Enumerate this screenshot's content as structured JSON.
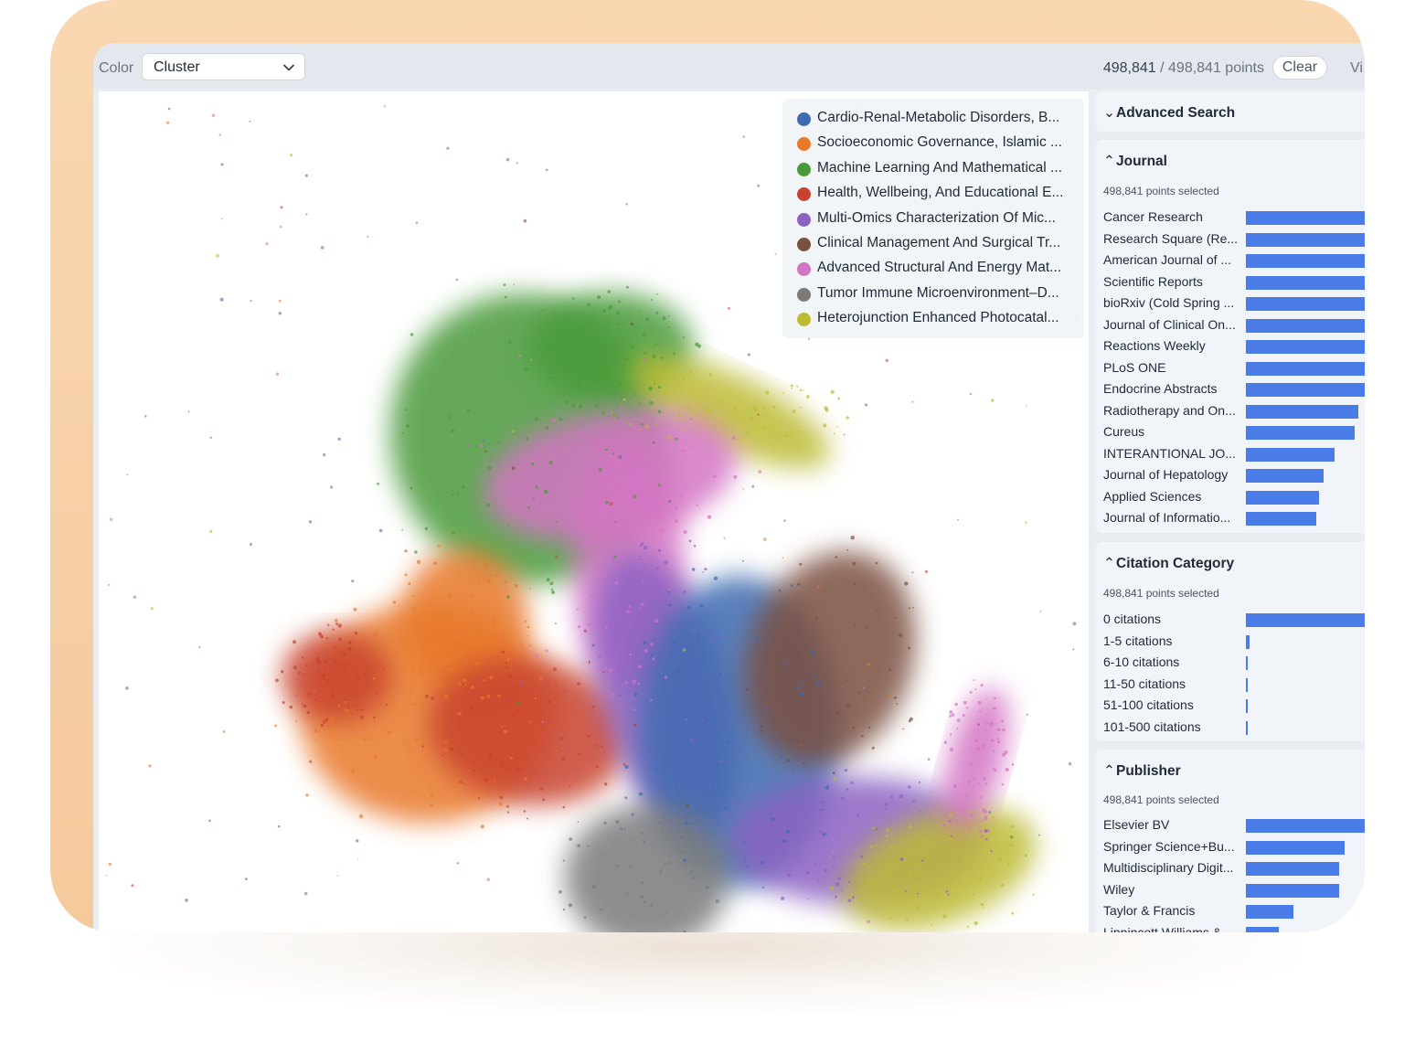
{
  "toolbar": {
    "color_label": "Color",
    "color_select_value": "Cluster",
    "points_selected": "498,841",
    "points_total": "/ 498,841 points",
    "clear_label": "Clear",
    "view_label": "Vi"
  },
  "legend": {
    "items": [
      {
        "label": "Cardio-Renal-Metabolic Disorders, B...",
        "color": "#3d6bb0"
      },
      {
        "label": "Socioeconomic Governance, Islamic ...",
        "color": "#e8782a"
      },
      {
        "label": "Machine Learning And Mathematical ...",
        "color": "#4a9a3a"
      },
      {
        "label": "Health, Wellbeing, And Educational E...",
        "color": "#c8422f"
      },
      {
        "label": "Multi-Omics Characterization Of Mic...",
        "color": "#8b62c2"
      },
      {
        "label": "Clinical Management And Surgical Tr...",
        "color": "#7a5041"
      },
      {
        "label": "Advanced Structural And Energy Mat...",
        "color": "#d474c4"
      },
      {
        "label": "Tumor Immune Microenvironment–D...",
        "color": "#7a7a7a"
      },
      {
        "label": "Heterojunction Enhanced Photocatal...",
        "color": "#bdbb35"
      }
    ]
  },
  "sidebar": {
    "advanced_search": {
      "title": "Advanced Search"
    },
    "journal": {
      "title": "Journal",
      "subtitle": "498,841 points selected",
      "bar_color": "#4a7ce8",
      "rows": [
        {
          "label": "Cancer Research",
          "fraction": 1.0
        },
        {
          "label": "Research Square (Re...",
          "fraction": 1.0
        },
        {
          "label": "American Journal of ...",
          "fraction": 1.0
        },
        {
          "label": "Scientific Reports",
          "fraction": 1.0
        },
        {
          "label": "bioRxiv (Cold Spring ...",
          "fraction": 1.0
        },
        {
          "label": "Journal of Clinical On...",
          "fraction": 1.0
        },
        {
          "label": "Reactions Weekly",
          "fraction": 1.0
        },
        {
          "label": "PLoS ONE",
          "fraction": 0.96
        },
        {
          "label": "Endocrine Abstracts",
          "fraction": 0.94
        },
        {
          "label": "Radiotherapy and On...",
          "fraction": 0.88
        },
        {
          "label": "Cureus",
          "fraction": 0.85
        },
        {
          "label": "INTERANTIONAL JO...",
          "fraction": 0.69
        },
        {
          "label": "Journal of Hepatology",
          "fraction": 0.61
        },
        {
          "label": "Applied Sciences",
          "fraction": 0.57
        },
        {
          "label": "Journal of Informatio...",
          "fraction": 0.55
        }
      ]
    },
    "citation": {
      "title": "Citation Category",
      "subtitle": "498,841 points selected",
      "rows": [
        {
          "label": "0 citations",
          "fraction": 1.0
        },
        {
          "label": "1-5 citations",
          "fraction": 0.03
        },
        {
          "label": "6-10 citations",
          "fraction": 0.012
        },
        {
          "label": "11-50 citations",
          "fraction": 0.012
        },
        {
          "label": "51-100 citations",
          "fraction": 0.012
        },
        {
          "label": "101-500 citations",
          "fraction": 0.012
        }
      ]
    },
    "publisher": {
      "title": "Publisher",
      "subtitle": "498,841 points selected",
      "rows": [
        {
          "label": "Elsevier BV",
          "fraction": 1.0
        },
        {
          "label": "Springer Science+Bu...",
          "fraction": 0.77
        },
        {
          "label": "Multidisciplinary Digit...",
          "fraction": 0.73
        },
        {
          "label": "Wiley",
          "fraction": 0.73
        },
        {
          "label": "Taylor & Francis",
          "fraction": 0.37
        },
        {
          "label": "Lippincott Williams &...",
          "fraction": 0.26
        }
      ]
    }
  }
}
